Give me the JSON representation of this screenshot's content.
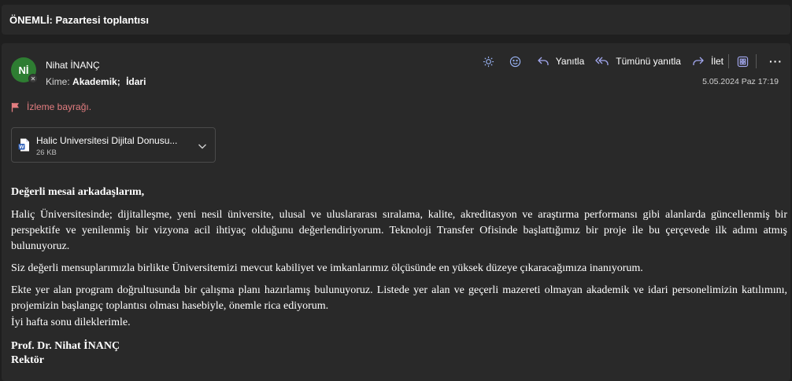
{
  "subject": "ÖNEMLİ: Pazartesi toplantısı",
  "sender": {
    "initials": "Nİ",
    "name": "Nihat İNANÇ",
    "to_label": "Kime:",
    "recipients": [
      "Akademik;",
      "İdari"
    ]
  },
  "toolbar": {
    "reply_label": "Yanıtla",
    "reply_all_label": "Tümünü yanıtla",
    "forward_label": "İlet"
  },
  "date": "5.05.2024 Paz 17:19",
  "flag_text": "İzleme bayrağı.",
  "attachment": {
    "name": "Halic Universitesi Dijital Donusu...",
    "size": "26 KB"
  },
  "body": {
    "greeting": "Değerli mesai arkadaşlarım,",
    "paragraph1": "Haliç Üniversitesinde; dijitalleşme, yeni nesil üniversite, ulusal ve uluslararası sıralama, kalite, akreditasyon ve araştırma performansı gibi alanlarda güncellenmiş bir perspektife ve yenilenmiş bir vizyona acil ihtiyaç olduğunu değerlendiriyorum. Teknoloji Transfer Ofisinde başlattığımız bir proje ile bu çerçevede ilk adımı atmış bulunuyoruz.",
    "paragraph2": "Siz değerli mensuplarımızla birlikte Üniversitemizi mevcut kabiliyet ve imkanlarımız ölçüsünde en yüksek düzeye çıkaracağımıza inanıyorum.",
    "paragraph3": "Ekte yer alan program doğrultusunda bir çalışma planı hazırlamış bulunuyoruz. Listede yer alan ve geçerli mazereti olmayan akademik ve idari personelimizin katılımını, projemizin başlangıç toplantısı olması hasebiyle, önemle rica ediyorum.",
    "closing": "İyi hafta sonu dileklerimle.",
    "signature_name": "Prof. Dr. Nihat İNANÇ",
    "signature_title": "Rektör"
  },
  "colors": {
    "background": "#1f1f1f",
    "card": "#292929",
    "accent": "#a3a8f0",
    "flag": "#e37d80",
    "avatar": "#2e7d32"
  }
}
